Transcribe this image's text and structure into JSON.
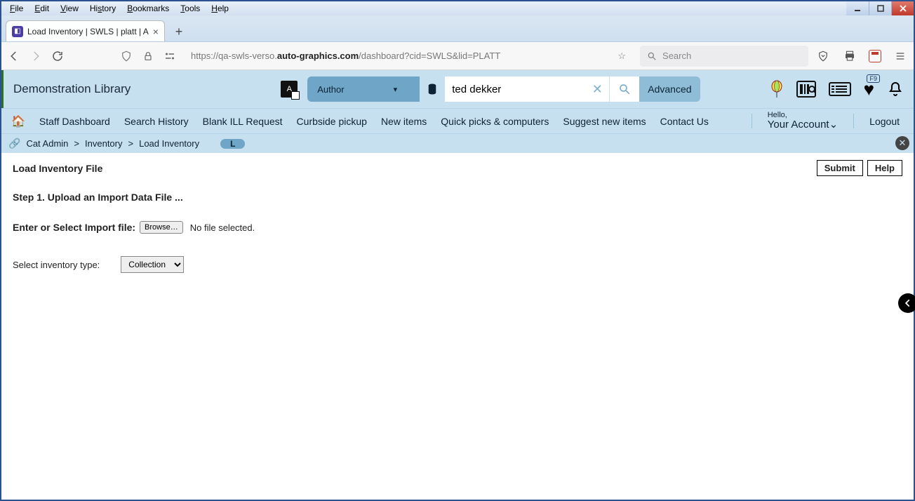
{
  "browser": {
    "menus": [
      "File",
      "Edit",
      "View",
      "History",
      "Bookmarks",
      "Tools",
      "Help"
    ],
    "tab_title": "Load Inventory | SWLS | platt | A",
    "url_prefix": "https://qa-swls-verso.",
    "url_host": "auto-graphics.com",
    "url_path": "/dashboard?cid=SWLS&lid=PLATT",
    "search_placeholder": "Search"
  },
  "header": {
    "library": "Demonstration Library",
    "search_type": "Author",
    "search_value": "ted dekker",
    "advanced": "Advanced",
    "heart_badge": "F9"
  },
  "nav": {
    "items": [
      "Staff Dashboard",
      "Search History",
      "Blank ILL Request",
      "Curbside pickup",
      "New items",
      "Quick picks & computers",
      "Suggest new items",
      "Contact Us"
    ],
    "hello": "Hello,",
    "account": "Your Account",
    "logout": "Logout"
  },
  "breadcrumb": {
    "a": "Cat Admin",
    "b": "Inventory",
    "c": "Load Inventory",
    "badge": "L"
  },
  "page": {
    "title": "Load Inventory File",
    "submit": "Submit",
    "help": "Help",
    "step1": "Step 1. Upload an Import Data File ...",
    "import_label": "Enter or Select Import file:",
    "browse": "Browse…",
    "nofile": "No file selected.",
    "type_label": "Select inventory type:",
    "type_value": "Collection"
  }
}
